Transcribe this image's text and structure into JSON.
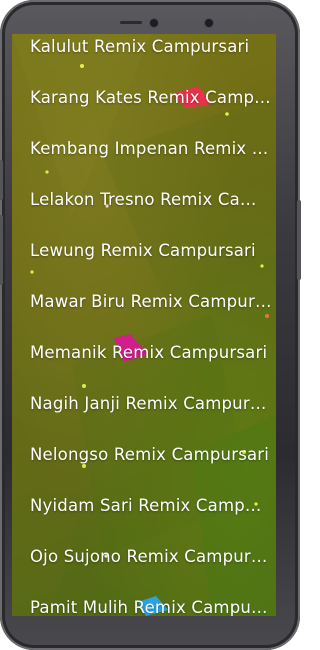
{
  "song_list": {
    "items": [
      {
        "label": "Kalulut Remix Campursari"
      },
      {
        "label": "Karang Kates Remix Campursari"
      },
      {
        "label": "Kembang Impenan Remix Campursari"
      },
      {
        "label": "Lelakon Tresno Remix Campursari"
      },
      {
        "label": "Lewung Remix Campursari"
      },
      {
        "label": "Mawar Biru Remix Campursari"
      },
      {
        "label": "Memanik Remix Campursari"
      },
      {
        "label": "Nagih Janji Remix Campursari"
      },
      {
        "label": "Nelongso Remix Campursari"
      },
      {
        "label": "Nyidam Sari Remix Campursari"
      },
      {
        "label": "Ojo Sujono Remix Campursari"
      },
      {
        "label": "Pamit Mulih Remix Campursari"
      }
    ]
  },
  "theme": {
    "text_color": "#ffffff",
    "background_color": "#6d6a17",
    "frame_color": "#3b3b3f"
  }
}
